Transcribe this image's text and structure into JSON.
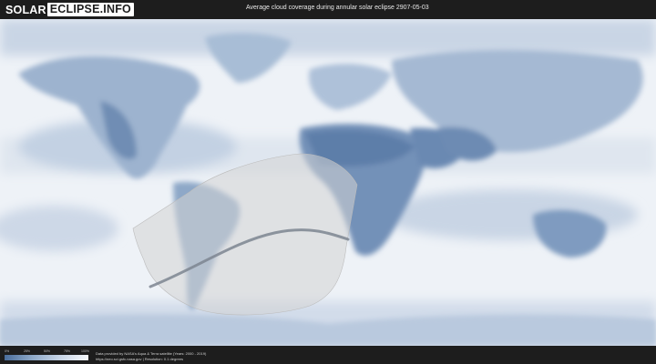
{
  "header": {
    "logo_part1": "SOLAR",
    "logo_part2": "ECLIPSE.INFO",
    "title": "Average cloud coverage during annular solar eclipse 2907-05-03"
  },
  "map": {
    "projection": "equirectangular world map",
    "layers": [
      "cloud-coverage",
      "eclipse-visibility-zone",
      "annularity-path"
    ],
    "colors": {
      "clear": "#4f72a0",
      "cloudy": "#f4f6f9",
      "visibility_zone": "#d7d7d7",
      "annularity_path": "#7c8590"
    }
  },
  "legend": {
    "ticks": [
      "0%",
      "25%",
      "50%",
      "75%",
      "100%"
    ]
  },
  "footer": {
    "credit_line1": "Data provided by NASA's Aqua & Terra satellite (Years: 2000 - 2019)",
    "credit_line2": "https://neo.sci.gsfc.nasa.gov | Resolution: 0.1 degrees"
  }
}
